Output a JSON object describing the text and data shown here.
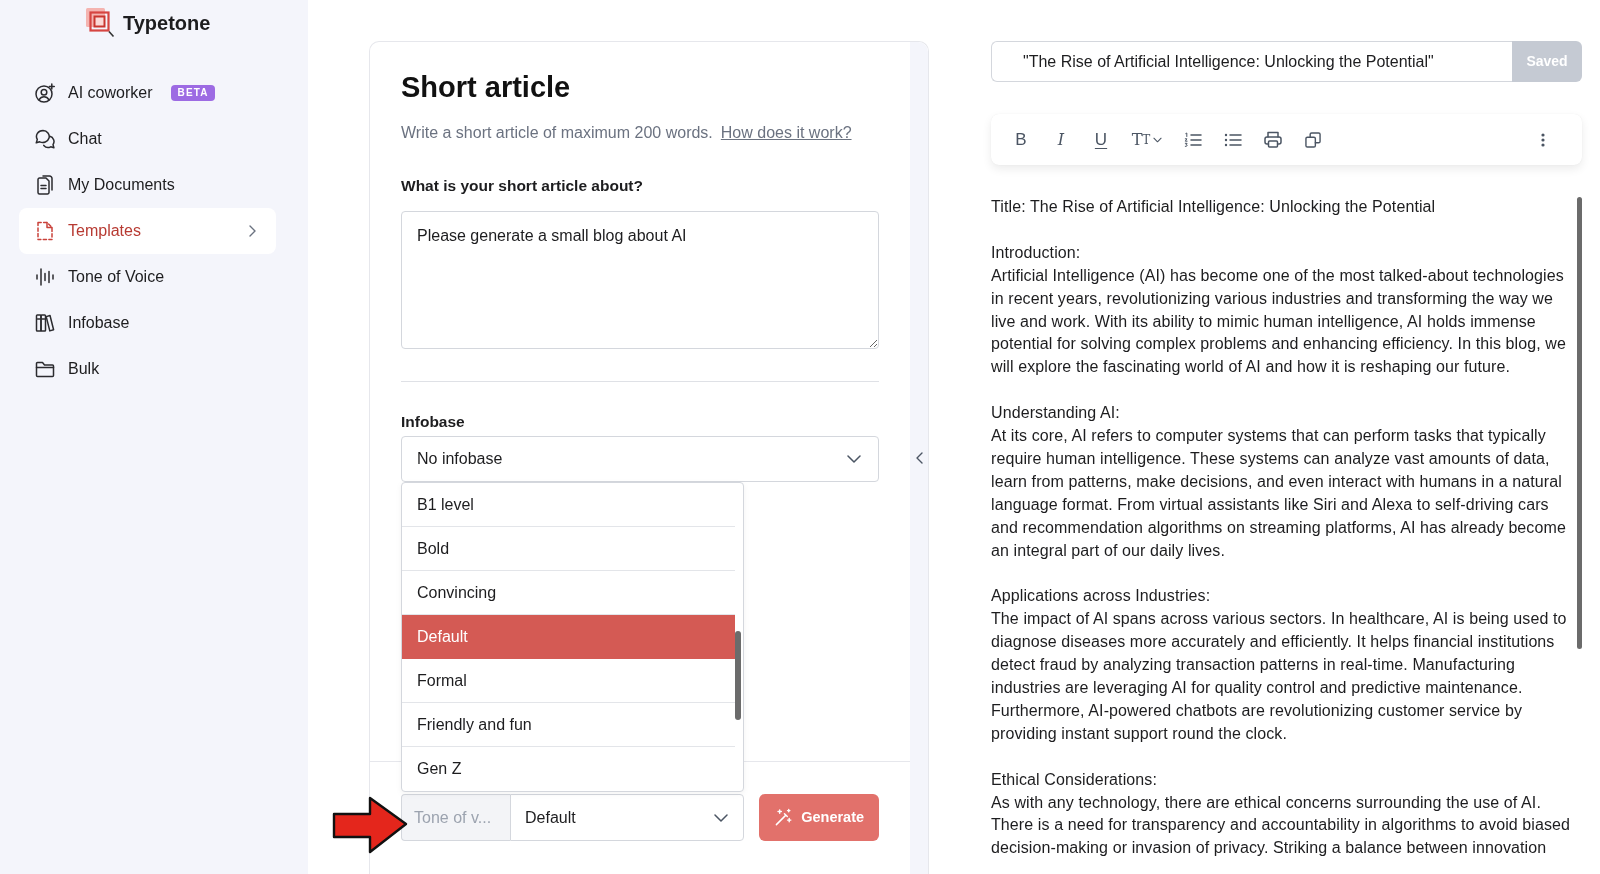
{
  "sidebar": {
    "brand": "Typetone",
    "items": [
      {
        "label": "AI coworker",
        "badge": "BETA",
        "selected": false
      },
      {
        "label": "Chat",
        "selected": false
      },
      {
        "label": "My Documents",
        "selected": false
      },
      {
        "label": "Templates",
        "selected": true,
        "submenu": true
      },
      {
        "label": "Tone of Voice",
        "selected": false
      },
      {
        "label": "Infobase",
        "selected": false
      },
      {
        "label": "Bulk",
        "selected": false
      }
    ]
  },
  "form": {
    "title": "Short article",
    "description": "Write a short article of maximum 200 words.",
    "help_link": "How does it work?",
    "topic_field": {
      "label": "What is your short article about?",
      "value": "Please generate a small blog about AI"
    },
    "infobase_field": {
      "label": "Infobase",
      "value": "No infobase"
    },
    "tone_field": {
      "label": "Tone of v...",
      "value": "Default",
      "expanded": true,
      "options": [
        {
          "label": "B1 level",
          "selected": false
        },
        {
          "label": "Bold",
          "selected": false
        },
        {
          "label": "Convincing",
          "selected": false
        },
        {
          "label": "Default",
          "selected": true
        },
        {
          "label": "Formal",
          "selected": false
        },
        {
          "label": "Friendly and fun",
          "selected": false
        },
        {
          "label": "Gen Z",
          "selected": false
        }
      ]
    },
    "generate_button": "Generate"
  },
  "editor": {
    "title_value": "\"The Rise of Artificial Intelligence: Unlocking the Potential\"",
    "save_button": {
      "label": "Saved",
      "disabled": true
    },
    "toolbar": [
      {
        "kind": "bold",
        "glyph": "B"
      },
      {
        "kind": "italic",
        "glyph": "I"
      },
      {
        "kind": "underline",
        "glyph": "U"
      },
      {
        "kind": "text-size",
        "glyph": "TT"
      },
      {
        "kind": "ordered-list"
      },
      {
        "kind": "bullet-list"
      },
      {
        "kind": "print"
      },
      {
        "kind": "copy"
      },
      {
        "kind": "more"
      }
    ],
    "document": {
      "title_line": "Title: The Rise of Artificial Intelligence: Unlocking the Potential",
      "sections": [
        {
          "heading": "Introduction:",
          "body": "Artificial Intelligence (AI) has become one of the most talked-about technologies\nin recent years, revolutionizing various industries and transforming the way we\nlive and work. With its ability to mimic human intelligence, AI holds immense\npotential for solving complex problems and enhancing efficiency. In this blog, we\nwill explore the fascinating world of AI and how it is reshaping our future."
        },
        {
          "heading": "Understanding AI:",
          "body": "At its core, AI refers to computer systems that can perform tasks that typically\nrequire human intelligence. These systems can analyze vast amounts of data,\nlearn from patterns, make decisions, and even interact with humans in a natural\nlanguage format. From virtual assistants like Siri and Alexa to self-driving cars\nand recommendation algorithms on streaming platforms, AI has already become\nan integral part of our daily lives."
        },
        {
          "heading": "Applications across Industries:",
          "body": "The impact of AI spans across various sectors. In healthcare, AI is being used to\ndiagnose diseases more accurately and efficiently. It helps financial institutions\ndetect fraud by analyzing transaction patterns in real-time. Manufacturing\nindustries are leveraging AI for quality control and predictive maintenance.\nFurthermore, AI-powered chatbots are revolutionizing customer service by\nproviding instant support round the clock."
        },
        {
          "heading": "Ethical Considerations:",
          "body": "As with any technology, there are ethical concerns surrounding the use of AI.\nThere is a need for transparency and accountability in algorithms to avoid biased\ndecision-making or invasion of privacy. Striking a balance between innovation"
        }
      ]
    }
  }
}
